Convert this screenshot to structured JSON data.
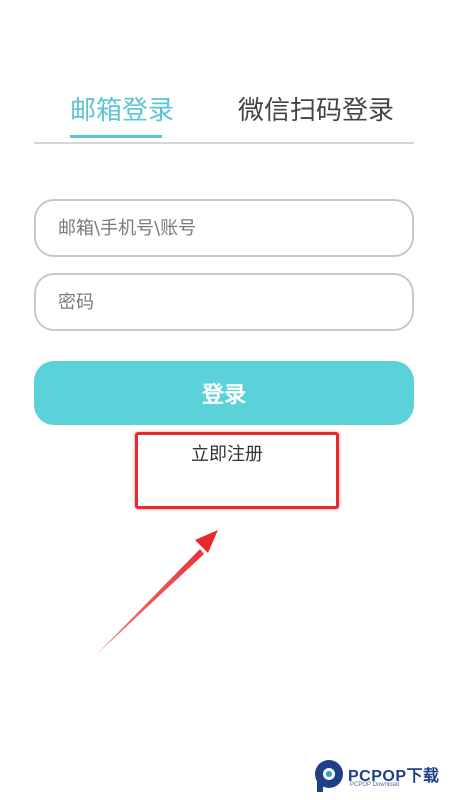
{
  "tabs": {
    "email_login": "邮箱登录",
    "wechat_login": "微信扫码登录",
    "active_tab": "email_login"
  },
  "form": {
    "account_placeholder": "邮箱\\手机号\\账号",
    "password_placeholder": "密码",
    "login_label": "登录",
    "register_label": "立即注册"
  },
  "watermark": {
    "brand": "PCPOP下载",
    "sub": "PCPOP Download"
  },
  "colors": {
    "accent": "#5bc5d2",
    "button": "#5bd2da",
    "annotation": "#e8282b",
    "brand": "#1f3f8a"
  }
}
